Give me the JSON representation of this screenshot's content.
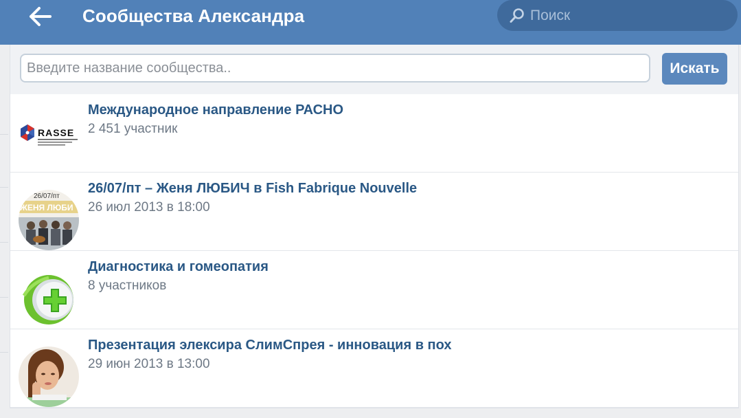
{
  "header": {
    "title": "Сообщества Александра",
    "search_placeholder": "Поиск",
    "back_icon": "arrow-left-icon",
    "search_icon": "magnifier-icon",
    "color": "#5181b8"
  },
  "community_search": {
    "placeholder": "Введите название сообщества..",
    "button_label": "Искать"
  },
  "communities": [
    {
      "title": "Международное направление РАСНО",
      "subtitle": "2 451 участник",
      "avatar": "rasse-logo",
      "avatar_text": "RASSE"
    },
    {
      "title": "26/07/пт – Женя ЛЮБИЧ в Fish Fabrique Nouvelle",
      "subtitle": "26 июл 2013 в 18:00",
      "avatar": "concert-poster-photo",
      "avatar_text_top": "26/07/пт",
      "avatar_text_mid": "ЖЕНЯ ЛЮБИ"
    },
    {
      "title": "Диагностика и гомеопатия",
      "subtitle": "8 участников",
      "avatar": "green-cross-icon"
    },
    {
      "title": "Презентация элексира СлимСпрея - инновация в пох",
      "subtitle": "29 июн 2013 в 13:00",
      "avatar": "woman-portrait-photo"
    }
  ],
  "colors": {
    "link": "#2a5885",
    "secondary_text": "#6d7885",
    "button": "#5b88bd"
  }
}
